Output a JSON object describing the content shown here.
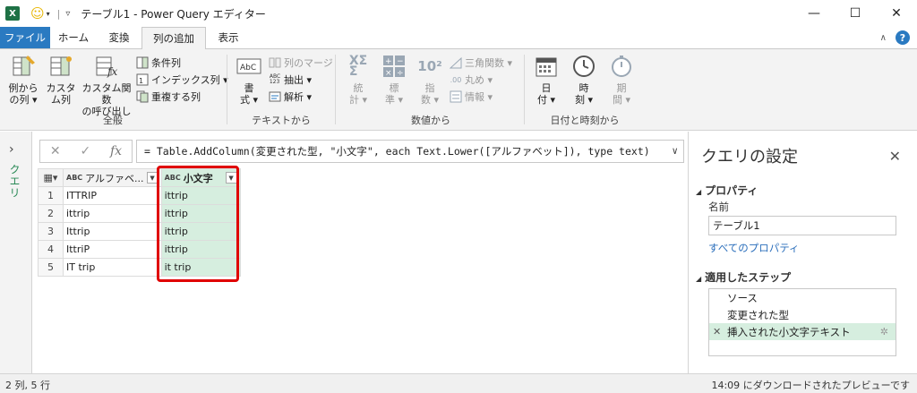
{
  "titlebar": {
    "title": "テーブル1 - Power Query エディター",
    "app_icon_letter": "X",
    "minimize": "—",
    "maximize": "☐",
    "close": "✕"
  },
  "tabs": {
    "items": [
      "ファイル",
      "ホーム",
      "変換",
      "列の追加",
      "表示"
    ],
    "active": "列の追加"
  },
  "ribbon": {
    "general": {
      "label": "全般",
      "col_from_examples": [
        "例から",
        "の列 ▾"
      ],
      "custom_col": [
        "カスタ",
        "ム列"
      ],
      "invoke_custom_fn": [
        "カスタム関数",
        "の呼び出し"
      ],
      "conditional_col": "条件列",
      "index_col": "インデックス列 ▾",
      "duplicate_col": "重複する列"
    },
    "text": {
      "label": "テキストから",
      "format": [
        "書",
        "式 ▾"
      ],
      "merge_cols": "列のマージ",
      "extract": "抽出 ▾",
      "parse": "解析 ▾"
    },
    "number": {
      "label": "数値から",
      "statistics": [
        "統",
        "計 ▾"
      ],
      "standard": [
        "標",
        "準 ▾"
      ],
      "scientific": [
        "指",
        "数 ▾"
      ],
      "trig": "三角関数 ▾",
      "rounding": "丸め ▾",
      "information": "情報 ▾"
    },
    "datetime": {
      "label": "日付と時刻から",
      "date": [
        "日",
        "付 ▾"
      ],
      "time": [
        "時",
        "刻 ▾"
      ],
      "duration": [
        "期",
        "間 ▾"
      ]
    }
  },
  "query_pane": {
    "arrow": "›",
    "label": "クエリ"
  },
  "formula_bar": {
    "cancel": "✕",
    "commit": "✓",
    "fx": "fx",
    "formula": "= Table.AddColumn(変更された型, \"小文字\", each Text.Lower([アルファベット]), type text)"
  },
  "grid": {
    "columns": [
      {
        "type": "ABC",
        "name": "アルファベ..."
      },
      {
        "type": "ABC",
        "name": "小文字"
      }
    ],
    "rows": [
      {
        "num": "1",
        "a": "ITTRIP",
        "b": "ittrip"
      },
      {
        "num": "2",
        "a": "ittrip",
        "b": "ittrip"
      },
      {
        "num": "3",
        "a": "Ittrip",
        "b": "ittrip"
      },
      {
        "num": "4",
        "a": "IttriP",
        "b": "ittrip"
      },
      {
        "num": "5",
        "a": "IT trip",
        "b": "it trip"
      }
    ],
    "highlight_color": "#e00000"
  },
  "settings": {
    "title": "クエリの設定",
    "close": "✕",
    "properties_header": "プロパティ",
    "name_label": "名前",
    "name_value": "テーブル1",
    "all_properties": "すべてのプロパティ",
    "steps_header": "適用したステップ",
    "steps": [
      "ソース",
      "変更された型",
      "挿入された小文字テキスト"
    ]
  },
  "status": {
    "left": "2 列, 5 行",
    "right": "14:09 にダウンロードされたプレビューです"
  },
  "colors": {
    "file_tab": "#2a7ac1",
    "accent_green": "#2a8a57",
    "selected_col": "#d6eedf"
  }
}
